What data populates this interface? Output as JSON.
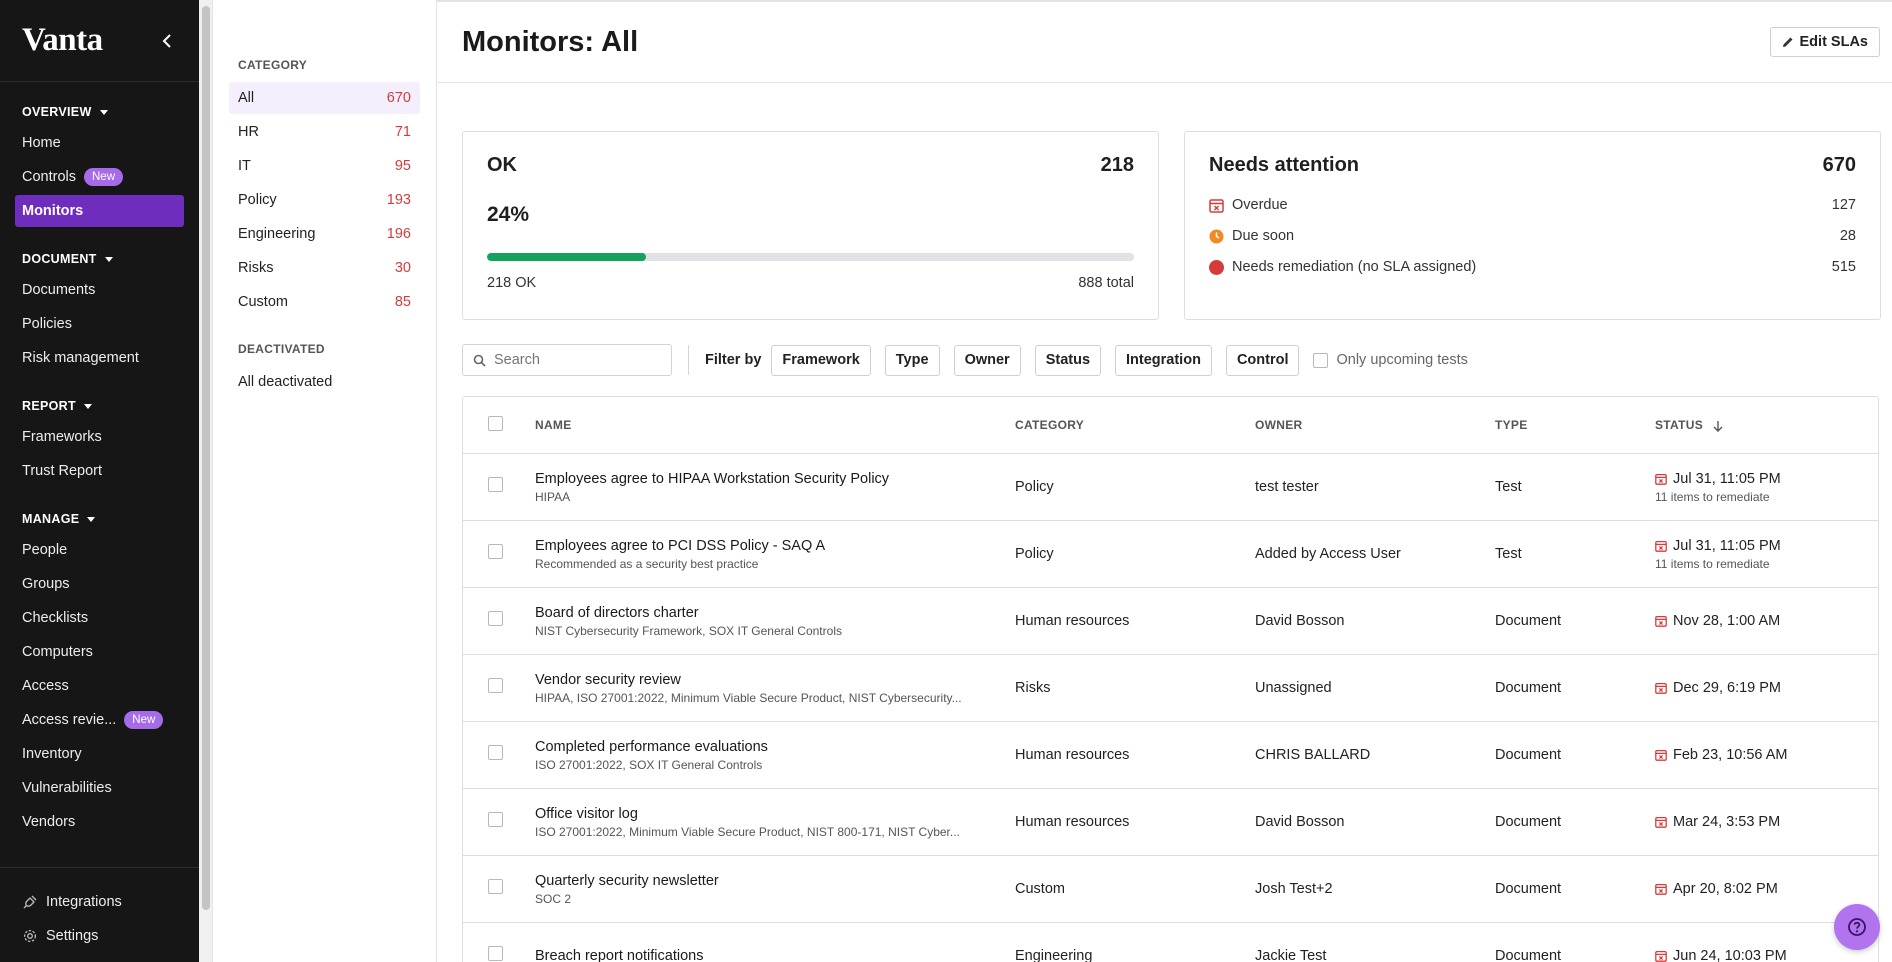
{
  "app": {
    "logo": "Vanta"
  },
  "sidebar": {
    "sections": [
      {
        "title": "OVERVIEW",
        "items": [
          {
            "label": "Home"
          },
          {
            "label": "Controls",
            "badge": "New"
          },
          {
            "label": "Monitors",
            "active": true
          }
        ]
      },
      {
        "title": "DOCUMENT",
        "items": [
          {
            "label": "Documents"
          },
          {
            "label": "Policies"
          },
          {
            "label": "Risk management"
          }
        ]
      },
      {
        "title": "REPORT",
        "items": [
          {
            "label": "Frameworks"
          },
          {
            "label": "Trust Report"
          }
        ]
      },
      {
        "title": "MANAGE",
        "items": [
          {
            "label": "People"
          },
          {
            "label": "Groups"
          },
          {
            "label": "Checklists"
          },
          {
            "label": "Computers"
          },
          {
            "label": "Access"
          },
          {
            "label": "Access revie...",
            "badge": "New"
          },
          {
            "label": "Inventory"
          },
          {
            "label": "Vulnerabilities"
          },
          {
            "label": "Vendors"
          }
        ]
      }
    ],
    "bottom": [
      {
        "label": "Integrations",
        "icon": "plug-icon"
      },
      {
        "label": "Settings",
        "icon": "gear-icon"
      }
    ]
  },
  "categories": {
    "heading": "CATEGORY",
    "items": [
      {
        "label": "All",
        "count": "670",
        "active": true
      },
      {
        "label": "HR",
        "count": "71"
      },
      {
        "label": "IT",
        "count": "95"
      },
      {
        "label": "Policy",
        "count": "193"
      },
      {
        "label": "Engineering",
        "count": "196"
      },
      {
        "label": "Risks",
        "count": "30"
      },
      {
        "label": "Custom",
        "count": "85"
      }
    ],
    "deactivated_heading": "DEACTIVATED",
    "deactivated_item": "All deactivated"
  },
  "header": {
    "title": "Monitors: All",
    "edit_slas": "Edit SLAs"
  },
  "ok_card": {
    "title": "OK",
    "count": "218",
    "percent": "24%",
    "progress": 0.245,
    "ok_label": "218 OK",
    "total_label": "888 total",
    "progress_color": "#13a35c"
  },
  "attention_card": {
    "title": "Needs attention",
    "count": "670",
    "rows": [
      {
        "label": "Overdue",
        "count": "127",
        "icon": "overdue-calendar-icon",
        "color": "#d63b3b"
      },
      {
        "label": "Due soon",
        "count": "28",
        "icon": "clock-icon",
        "color": "#f08a24"
      },
      {
        "label": "Needs remediation (no SLA assigned)",
        "count": "515",
        "icon": "red-dot-icon",
        "color": "#d63b3b"
      }
    ]
  },
  "filters": {
    "search_placeholder": "Search",
    "filter_by": "Filter by",
    "chips": [
      "Framework",
      "Type",
      "Owner",
      "Status",
      "Integration",
      "Control"
    ],
    "upcoming": "Only upcoming tests"
  },
  "table": {
    "headers": {
      "name": "NAME",
      "category": "CATEGORY",
      "owner": "OWNER",
      "type": "TYPE",
      "status": "STATUS"
    },
    "rows": [
      {
        "name": "Employees agree to HIPAA Workstation Security Policy",
        "frameworks": "HIPAA",
        "category": "Policy",
        "owner": "test tester",
        "type": "Test",
        "status": "Jul 31, 11:05 PM",
        "status_sub": "11 items to remediate"
      },
      {
        "name": "Employees agree to PCI DSS Policy - SAQ A",
        "frameworks": "Recommended as a security best practice",
        "category": "Policy",
        "owner": "Added by Access User",
        "type": "Test",
        "status": "Jul 31, 11:05 PM",
        "status_sub": "11 items to remediate"
      },
      {
        "name": "Board of directors charter",
        "frameworks": "NIST Cybersecurity Framework, SOX IT General Controls",
        "category": "Human resources",
        "owner": "David Bosson",
        "type": "Document",
        "status": "Nov 28, 1:00 AM",
        "status_sub": ""
      },
      {
        "name": "Vendor security review",
        "frameworks": "HIPAA, ISO 27001:2022, Minimum Viable Secure Product, NIST Cybersecurity...",
        "category": "Risks",
        "owner": "Unassigned",
        "type": "Document",
        "status": "Dec 29, 6:19 PM",
        "status_sub": ""
      },
      {
        "name": "Completed performance evaluations",
        "frameworks": "ISO 27001:2022, SOX IT General Controls",
        "category": "Human resources",
        "owner": "CHRIS BALLARD",
        "type": "Document",
        "status": "Feb 23, 10:56 AM",
        "status_sub": ""
      },
      {
        "name": "Office visitor log",
        "frameworks": "ISO 27001:2022, Minimum Viable Secure Product, NIST 800-171, NIST Cyber...",
        "category": "Human resources",
        "owner": "David Bosson",
        "type": "Document",
        "status": "Mar 24, 3:53 PM",
        "status_sub": ""
      },
      {
        "name": "Quarterly security newsletter",
        "frameworks": "SOC 2",
        "category": "Custom",
        "owner": "Josh Test+2",
        "type": "Document",
        "status": "Apr 20, 8:02 PM",
        "status_sub": ""
      },
      {
        "name": "Breach report notifications",
        "frameworks": "",
        "category": "Engineering",
        "owner": "Jackie Test",
        "type": "Document",
        "status": "Jun 24, 10:03 PM",
        "status_sub": ""
      }
    ]
  }
}
